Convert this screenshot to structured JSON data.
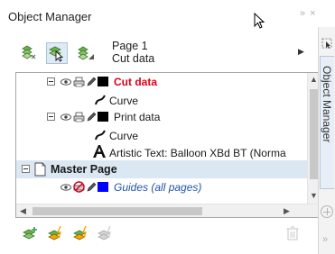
{
  "docker": {
    "title": "Object Manager",
    "title_controls": "»  ×",
    "side_tab_label": "Object Manager"
  },
  "page": {
    "name": "Page 1",
    "layer": "Cut data"
  },
  "tree": {
    "layer_cut": {
      "label": "Cut data",
      "color": "#e0001a",
      "swatch": "#000000"
    },
    "cut_curve": "Curve",
    "layer_print": {
      "label": "Print data",
      "swatch": "#000000"
    },
    "print_curve": "Curve",
    "artistic_text": "Artistic Text: Balloon XBd BT (Norma",
    "master_page": "Master Page",
    "guides": {
      "label": "Guides (all pages)",
      "color": "#2255aa",
      "swatch": "#0000ff"
    }
  },
  "colors": {
    "selection_highlight": "#dbe7f3",
    "accent_green": "#2e9d4f"
  }
}
